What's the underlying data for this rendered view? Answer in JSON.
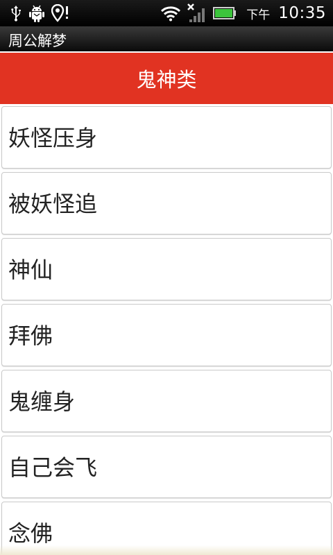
{
  "status_bar": {
    "time_period": "下午",
    "time": "10:35",
    "icons": [
      "usb-icon",
      "android-debug-icon",
      "location-alert-icon",
      "wifi-icon",
      "signal-icon",
      "battery-icon"
    ],
    "battery_color": "#3cc43c"
  },
  "app": {
    "title": "周公解梦"
  },
  "header": {
    "title": "鬼神类",
    "color": "#e13322"
  },
  "list": {
    "items": [
      {
        "label": "妖怪压身"
      },
      {
        "label": "被妖怪追"
      },
      {
        "label": "神仙"
      },
      {
        "label": "拜佛"
      },
      {
        "label": "鬼缠身"
      },
      {
        "label": "自己会飞"
      },
      {
        "label": "念佛"
      }
    ]
  }
}
